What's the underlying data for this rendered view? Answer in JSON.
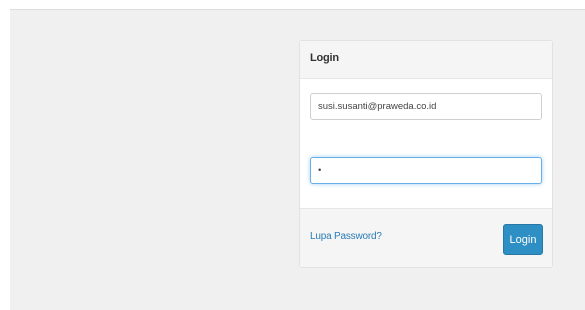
{
  "login": {
    "title": "Login",
    "email_value": "susi.susanti@praweda.co.id",
    "password_value": "•",
    "forgot_password": "Lupa Password?",
    "submit_label": "Login"
  },
  "colors": {
    "accent": "#2e8fc4",
    "link": "#2a7bb5",
    "focus": "#66afe9",
    "page_background": "#f0f0f0"
  }
}
